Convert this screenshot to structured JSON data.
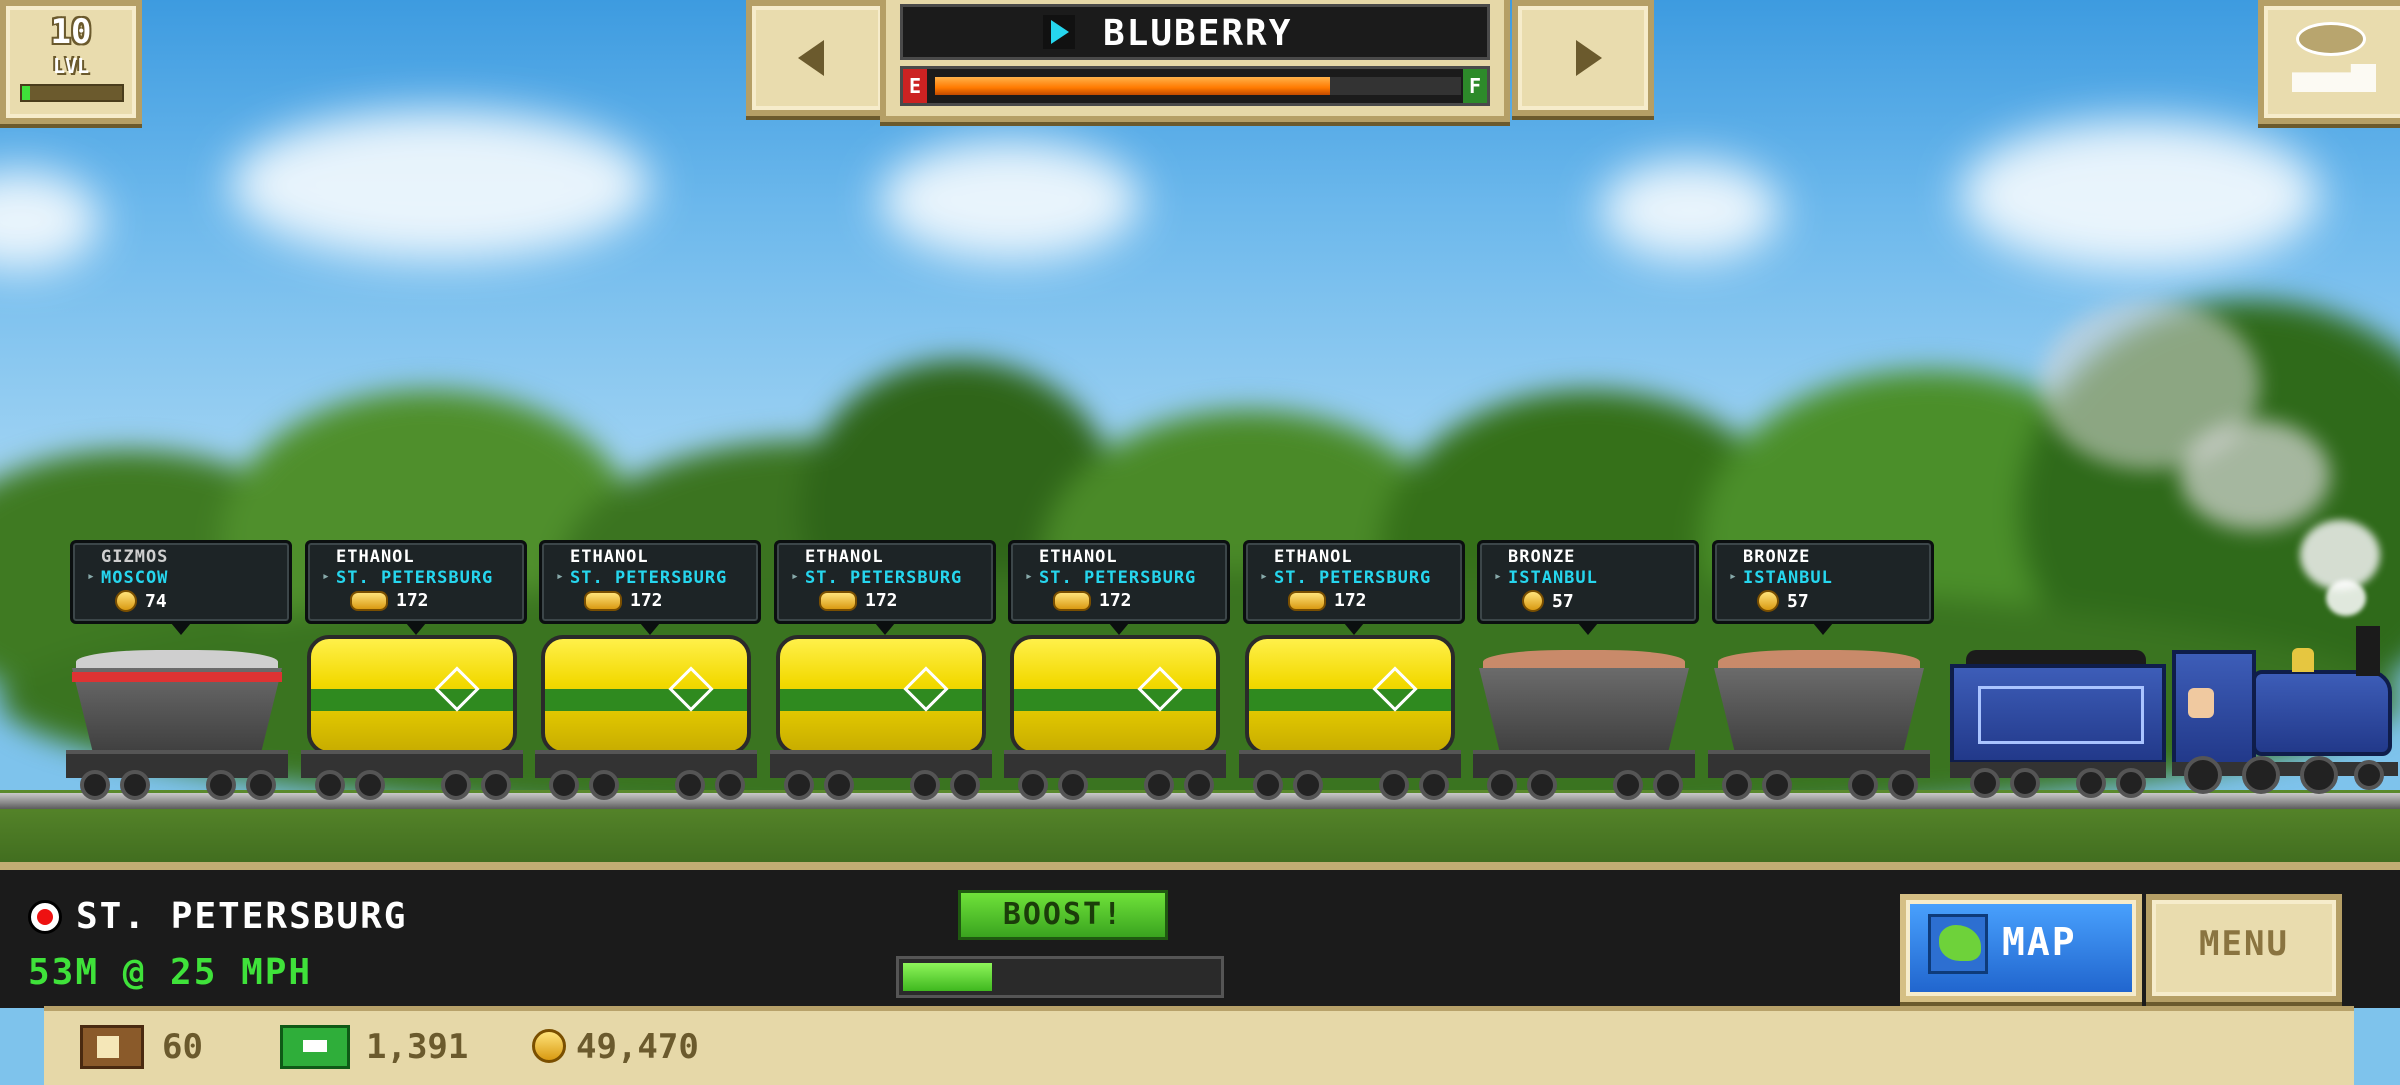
{
  "level": {
    "number": "10",
    "label": "LVL",
    "progress": 0.08
  },
  "train": {
    "name": "BLUBERRY",
    "fuel_empty_label": "E",
    "fuel_full_label": "F",
    "fuel_level": 0.75
  },
  "cars": [
    {
      "cargo": "GIZMOS",
      "destination": "MOSCOW",
      "payout": "74",
      "type": "hopper",
      "load_color": "#cfcfcf"
    },
    {
      "cargo": "ETHANOL",
      "destination": "ST. PETERSBURG",
      "payout": "172",
      "type": "tank"
    },
    {
      "cargo": "ETHANOL",
      "destination": "ST. PETERSBURG",
      "payout": "172",
      "type": "tank"
    },
    {
      "cargo": "ETHANOL",
      "destination": "ST. PETERSBURG",
      "payout": "172",
      "type": "tank"
    },
    {
      "cargo": "ETHANOL",
      "destination": "ST. PETERSBURG",
      "payout": "172",
      "type": "tank"
    },
    {
      "cargo": "ETHANOL",
      "destination": "ST. PETERSBURG",
      "payout": "172",
      "type": "tank"
    },
    {
      "cargo": "BRONZE",
      "destination": "ISTANBUL",
      "payout": "57",
      "type": "hopper",
      "load_color": "#c98a6a"
    },
    {
      "cargo": "BRONZE",
      "destination": "ISTANBUL",
      "payout": "57",
      "type": "hopper",
      "load_color": "#c98a6a"
    }
  ],
  "journey": {
    "destination": "ST. PETERSBURG",
    "distance_speed": "53M @ 25 MPH"
  },
  "boost": {
    "label": "BOOST!",
    "progress": 0.3
  },
  "buttons": {
    "map": "MAP",
    "menu": "MENU"
  },
  "resources": {
    "crates": "60",
    "cash": "1,391",
    "coins": "49,470"
  },
  "colors": {
    "accent_green": "#3fe23a",
    "destination_cyan": "#26d6ee",
    "panel_tan": "#e9dcae"
  }
}
